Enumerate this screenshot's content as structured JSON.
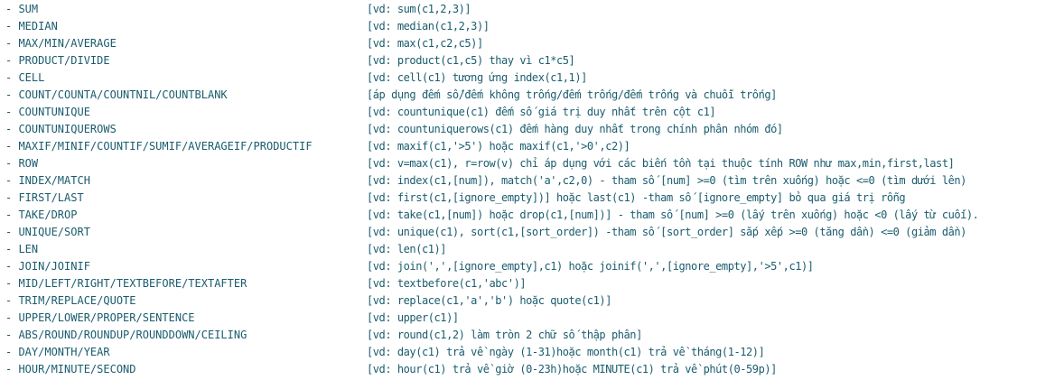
{
  "functions": [
    {
      "name": "- SUM",
      "desc": "[vd: sum(c1,2,3)]"
    },
    {
      "name": "- MEDIAN",
      "desc": "[vd: median(c1,2,3)]"
    },
    {
      "name": "- MAX/MIN/AVERAGE",
      "desc": "[vd: max(c1,c2,c5)]"
    },
    {
      "name": "- PRODUCT/DIVIDE",
      "desc": "[vd: product(c1,c5) thay vì c1*c5]"
    },
    {
      "name": "- CELL",
      "desc": "[vd: cell(c1) tương ứng index(c1,1)]"
    },
    {
      "name": "- COUNT/COUNTA/COUNTNIL/COUNTBLANK",
      "desc": "[áp dụng đếm số/đếm không trống/đếm trống/đếm trống và chuỗi trống]"
    },
    {
      "name": "- COUNTUNIQUE",
      "desc": "[vd: countunique(c1) đếm số giá trị duy nhất trên cột c1]"
    },
    {
      "name": "- COUNTUNIQUEROWS",
      "desc": "[vd: countuniquerows(c1) đếm hàng duy nhất trong chính phân nhóm đó]"
    },
    {
      "name": "- MAXIF/MINIF/COUNTIF/SUMIF/AVERAGEIF/PRODUCTIF",
      "desc": "[vd: maxif(c1,'>5') hoặc maxif(c1,'>0',c2)]"
    },
    {
      "name": "- ROW",
      "desc": "[vd: v=max(c1), r=row(v) chỉ áp dụng với các biến tồn tại thuộc tính ROW như max,min,first,last]"
    },
    {
      "name": "- INDEX/MATCH",
      "desc": "[vd: index(c1,[num]), match('a',c2,0) - tham số [num] >=0 (tìm trên xuống) hoặc <=0 (tìm dưới lên)"
    },
    {
      "name": "- FIRST/LAST",
      "desc": "[vd: first(c1,[ignore_empty])] hoặc last(c1) -tham số [ignore_empty] bỏ qua giá trị rỗng"
    },
    {
      "name": "- TAKE/DROP",
      "desc": "[vd: take(c1,[num]) hoặc drop(c1,[num])] - tham số [num] >=0 (lấy trên xuống) hoặc <0 (lấy từ cuối)."
    },
    {
      "name": "- UNIQUE/SORT",
      "desc": "[vd: unique(c1), sort(c1,[sort_order]) -tham số [sort_order] sắp xếp >=0 (tăng dần) <=0 (giảm dần)"
    },
    {
      "name": "- LEN",
      "desc": "[vd: len(c1)]"
    },
    {
      "name": "- JOIN/JOINIF",
      "desc": "[vd: join(',',[ignore_empty],c1) hoặc joinif(',',[ignore_empty],'>5',c1)]"
    },
    {
      "name": "- MID/LEFT/RIGHT/TEXTBEFORE/TEXTAFTER",
      "desc": "[vd: textbefore(c1,'abc')]"
    },
    {
      "name": "- TRIM/REPLACE/QUOTE",
      "desc": "[vd: replace(c1,'a','b') hoặc quote(c1)]"
    },
    {
      "name": "- UPPER/LOWER/PROPER/SENTENCE",
      "desc": "[vd: upper(c1)]"
    },
    {
      "name": "- ABS/ROUND/ROUNDUP/ROUNDDOWN/CEILING",
      "desc": "[vd: round(c1,2) làm tròn 2 chữ số thập phân]"
    },
    {
      "name": "- DAY/MONTH/YEAR",
      "desc": "[vd: day(c1) trả về ngày (1-31)hoặc month(c1) trả về tháng(1-12)]"
    },
    {
      "name": "- HOUR/MINUTE/SECOND",
      "desc": "[vd: hour(c1) trả về giờ (0-23h)hoặc MINUTE(c1) trả về phút(0-59p)]"
    }
  ]
}
